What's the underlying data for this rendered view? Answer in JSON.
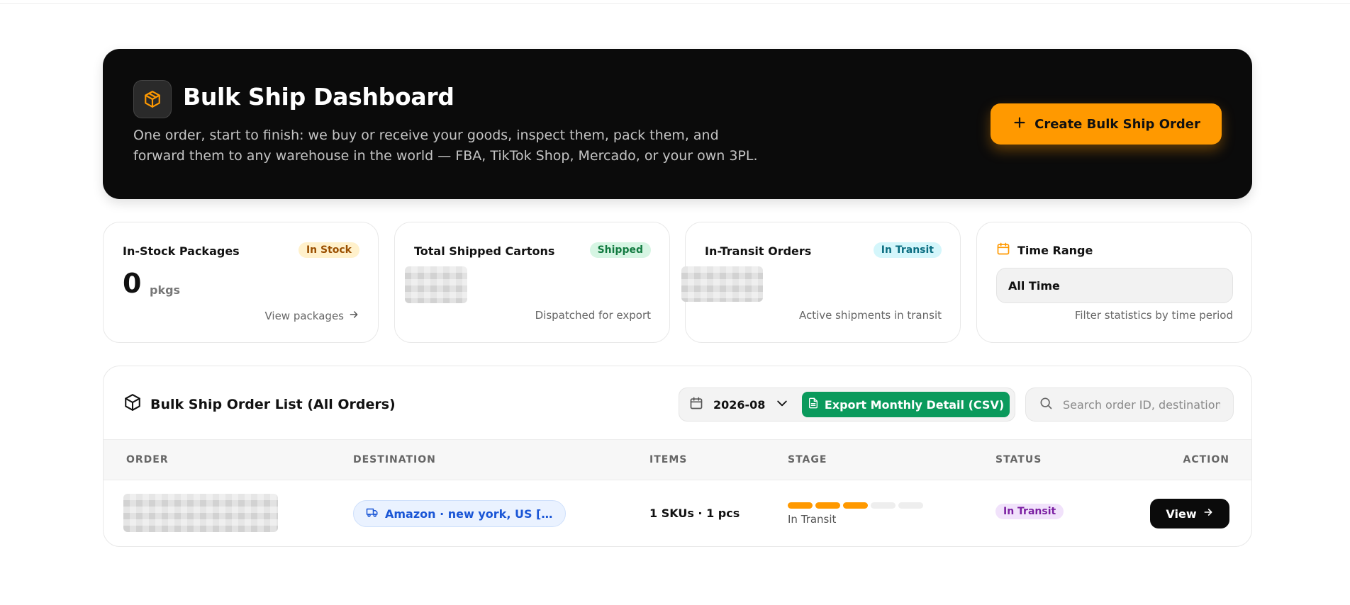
{
  "hero": {
    "title": "Bulk Ship Dashboard",
    "description": "One order, start to finish: we buy or receive your goods, inspect them, pack them, and forward them to any warehouse in the world — FBA, TikTok Shop, Mercado, or your own 3PL.",
    "logo_icon": "package-box-icon",
    "create_button_label": "Create Bulk Ship Order",
    "create_button_icon": "plus-icon"
  },
  "stats": {
    "in_stock": {
      "title": "In-Stock Packages",
      "badge": "In Stock",
      "value": "0",
      "unit": "pkgs",
      "link_label": "View packages"
    },
    "shipped": {
      "title": "Total Shipped Cartons",
      "badge": "Shipped",
      "footer": "Dispatched for export"
    },
    "in_transit": {
      "title": "In-Transit Orders",
      "badge": "In Transit",
      "footer": "Active shipments in transit"
    },
    "time_range": {
      "title": "Time Range",
      "selected": "All Time",
      "footer": "Filter statistics by time period"
    }
  },
  "orders": {
    "title": "Bulk Ship Order List (All Orders)",
    "month": "2026-08",
    "export_label": "Export Monthly Detail (CSV)",
    "search_placeholder": "Search order ID, destination",
    "columns": {
      "order": "ORDER",
      "destination": "DESTINATION",
      "items": "ITEMS",
      "stage": "STAGE",
      "status": "STATUS",
      "action": "ACTION"
    },
    "rows": [
      {
        "destination": "Amazon · new york, US [DD...",
        "items": "1 SKUs · 1 pcs",
        "stage_steps_total": 5,
        "stage_steps_done": 3,
        "stage_label": "In Transit",
        "status": "In Transit",
        "action_label": "View"
      }
    ]
  },
  "colors": {
    "accent": "#ff9900",
    "hero_bg": "#0b0b0b",
    "export_green": "#0a9a5c",
    "link_blue": "#1a56d6",
    "status_purple": "#7b1fa2"
  }
}
